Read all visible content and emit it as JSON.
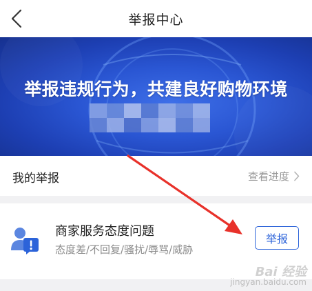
{
  "header": {
    "title": "举报中心",
    "back_icon": "chevron-left-icon"
  },
  "banner": {
    "slogan": "举报违规行为，共建良好购物环境",
    "blurred_text_present": true,
    "colors": {
      "primary": "#2a56d3",
      "dark": "#16318f"
    }
  },
  "my_reports": {
    "label": "我的举报",
    "progress_link": "查看进度",
    "chevron_icon": "chevron-right-icon"
  },
  "report_item": {
    "icon": "user-alert-icon",
    "title": "商家服务态度问题",
    "subtitle": "态度差/不回复/骚扰/辱骂/威胁",
    "button_label": "举报"
  },
  "annotation": {
    "arrow_color": "#e8312a",
    "arrow_icon": "red-arrow-icon"
  },
  "watermark": {
    "brand": "Bai 经验",
    "url": "jingyan.baidu.com"
  }
}
